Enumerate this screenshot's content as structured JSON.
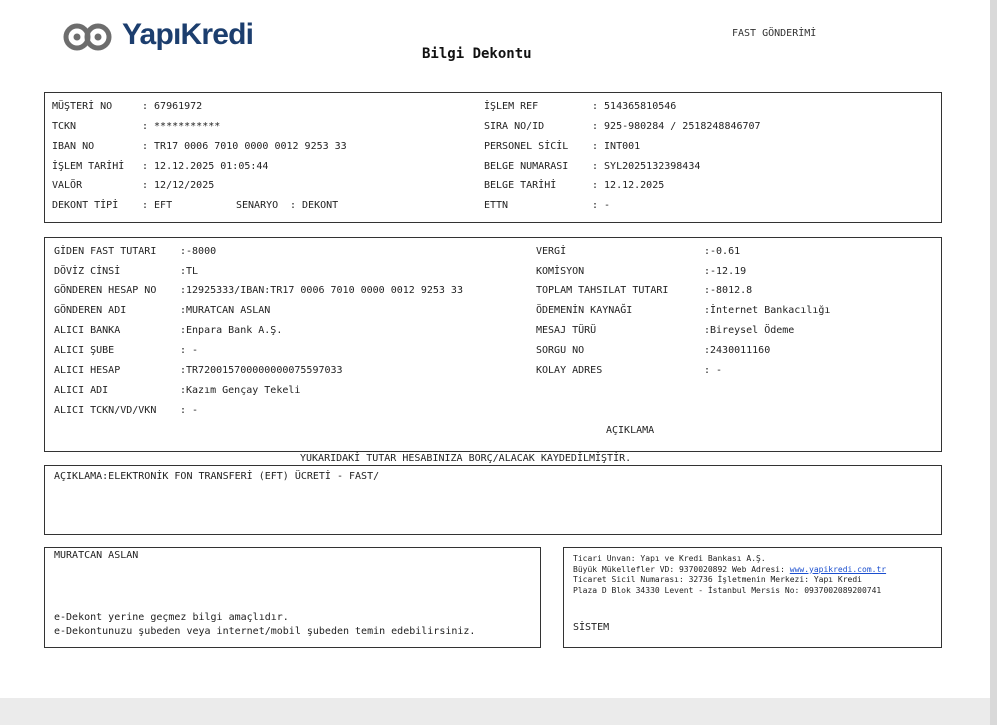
{
  "header": {
    "brand": "YapıKredi",
    "title": "Bilgi Dekontu",
    "service": "FAST GÖNDERİMİ"
  },
  "customer": {
    "left": [
      {
        "label": "MÜŞTERİ NO",
        "value": ": 67961972"
      },
      {
        "label": "TCKN",
        "value": ": ***********"
      },
      {
        "label": "IBAN NO",
        "value": ": TR17 0006 7010 0000 0012 9253 33"
      },
      {
        "label": "İŞLEM TARİHİ",
        "value": ": 12.12.2025 01:05:44"
      },
      {
        "label": "VALÖR",
        "value": ": 12/12/2025"
      },
      {
        "label": "DEKONT TİPİ",
        "value": ": EFT"
      }
    ],
    "scenario_label": "SENARYO",
    "scenario_value": ": DEKONT",
    "right": [
      {
        "label": "İŞLEM REF",
        "value": ": 514365810546"
      },
      {
        "label": "SIRA NO/ID",
        "value": ": 925-980284 / 2518248846707"
      },
      {
        "label": "PERSONEL SİCİL",
        "value": ": INT001"
      },
      {
        "label": "BELGE NUMARASI",
        "value": ": SYL2025132398434"
      },
      {
        "label": "BELGE TARİHİ",
        "value": ": 12.12.2025"
      },
      {
        "label": "ETTN",
        "value": ": -"
      }
    ]
  },
  "transfer": {
    "left": [
      {
        "label": "GİDEN FAST TUTARI",
        "value": ":-8000"
      },
      {
        "label": "DÖVİZ CİNSİ",
        "value": ":TL"
      },
      {
        "label": "GÖNDEREN HESAP NO",
        "value": ":12925333/IBAN:TR17 0006 7010 0000 0012 9253 33"
      },
      {
        "label": "GÖNDEREN ADI",
        "value": ":MURATCAN ASLAN"
      },
      {
        "label": "ALICI BANKA",
        "value": ":Enpara Bank A.Ş."
      },
      {
        "label": "ALICI ŞUBE",
        "value": ": -"
      },
      {
        "label": "ALICI HESAP",
        "value": ":TR720015700000000075597033"
      },
      {
        "label": "ALICI ADI",
        "value": ":Kazım Gençay Tekeli"
      },
      {
        "label": "ALICI TCKN/VD/VKN",
        "value": ": -"
      }
    ],
    "right": [
      {
        "label": "VERGİ",
        "value": ":-0.61"
      },
      {
        "label": "KOMİSYON",
        "value": ":-12.19"
      },
      {
        "label": "TOPLAM TAHSILAT TUTARI",
        "value": ":-8012.8"
      },
      {
        "label": "ÖDEMENİN KAYNAĞI",
        "value": ":İnternet Bankacılığı"
      },
      {
        "label": "MESAJ TÜRÜ",
        "value": ":Bireysel Ödeme"
      },
      {
        "label": "SORGU NO",
        "value": ":2430011160"
      },
      {
        "label": "KOLAY ADRES",
        "value": ": -"
      }
    ],
    "aciklama_heading": "AÇIKLAMA"
  },
  "notice": "YUKARIDAKİ TUTAR HESABINIZA BORÇ/ALACAK KAYDEDİLMİŞTİR.",
  "description": "AÇIKLAMA:ELEKTRONİK FON TRANSFERİ (EFT) ÜCRETİ - FAST/",
  "footer": {
    "name": "MURATCAN ASLAN",
    "note1": "e-Dekont yerine geçmez bilgi amaçlıdır.",
    "note2": "e-Dekontunuzu şubeden veya internet/mobil şubeden temin edebilirsiniz.",
    "bank_line1": "Ticari Unvan: Yapı ve Kredi Bankası A.Ş.",
    "bank_line2_prefix": "Büyük Mükellefler VD: 9370020892 Web Adresi: ",
    "bank_url": "www.yapikredi.com.tr",
    "bank_line3": "Ticaret Sicil Numarası: 32736 İşletmenin Merkezi: Yapı Kredi",
    "bank_line4": "Plaza D Blok 34330 Levent - İstanbul Mersis No: 0937002089200741",
    "system": "SİSTEM"
  },
  "colors": {
    "brand": "#1c3e6e",
    "logo_grey": "#6d6d6d",
    "link": "#1a4ecf"
  }
}
